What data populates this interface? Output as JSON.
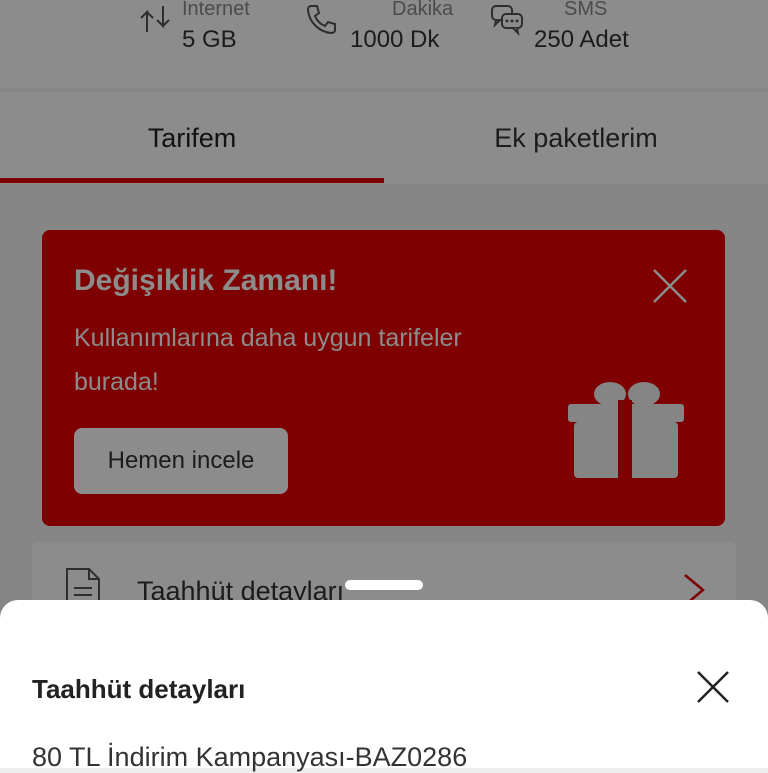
{
  "usage": {
    "internet": {
      "label": "Internet",
      "value": "5 GB",
      "icon": "data-transfer-icon"
    },
    "dakika": {
      "label": "Dakika",
      "value": "1000 Dk",
      "icon": "phone-icon"
    },
    "sms": {
      "label": "SMS",
      "value": "250 Adet",
      "icon": "chat-bubbles-icon"
    }
  },
  "tabs": [
    {
      "label": "Tarifem",
      "active": true
    },
    {
      "label": "Ek paketlerim",
      "active": false
    }
  ],
  "promo": {
    "title": "Değişiklik Zamanı!",
    "text": "Kullanımlarına daha uygun tarifeler burada!",
    "button": "Hemen incele",
    "icon": "gift-icon"
  },
  "list": {
    "commitment_row": {
      "label": "Taahhüt detayları",
      "icon": "document-icon"
    }
  },
  "sheet": {
    "title": "Taahhüt detayları",
    "first_item": "80 TL İndirim Kampanyası-BAZ0286"
  },
  "colors": {
    "brand": "#e60000",
    "text": "#333333",
    "muted": "#8a8a8a"
  }
}
